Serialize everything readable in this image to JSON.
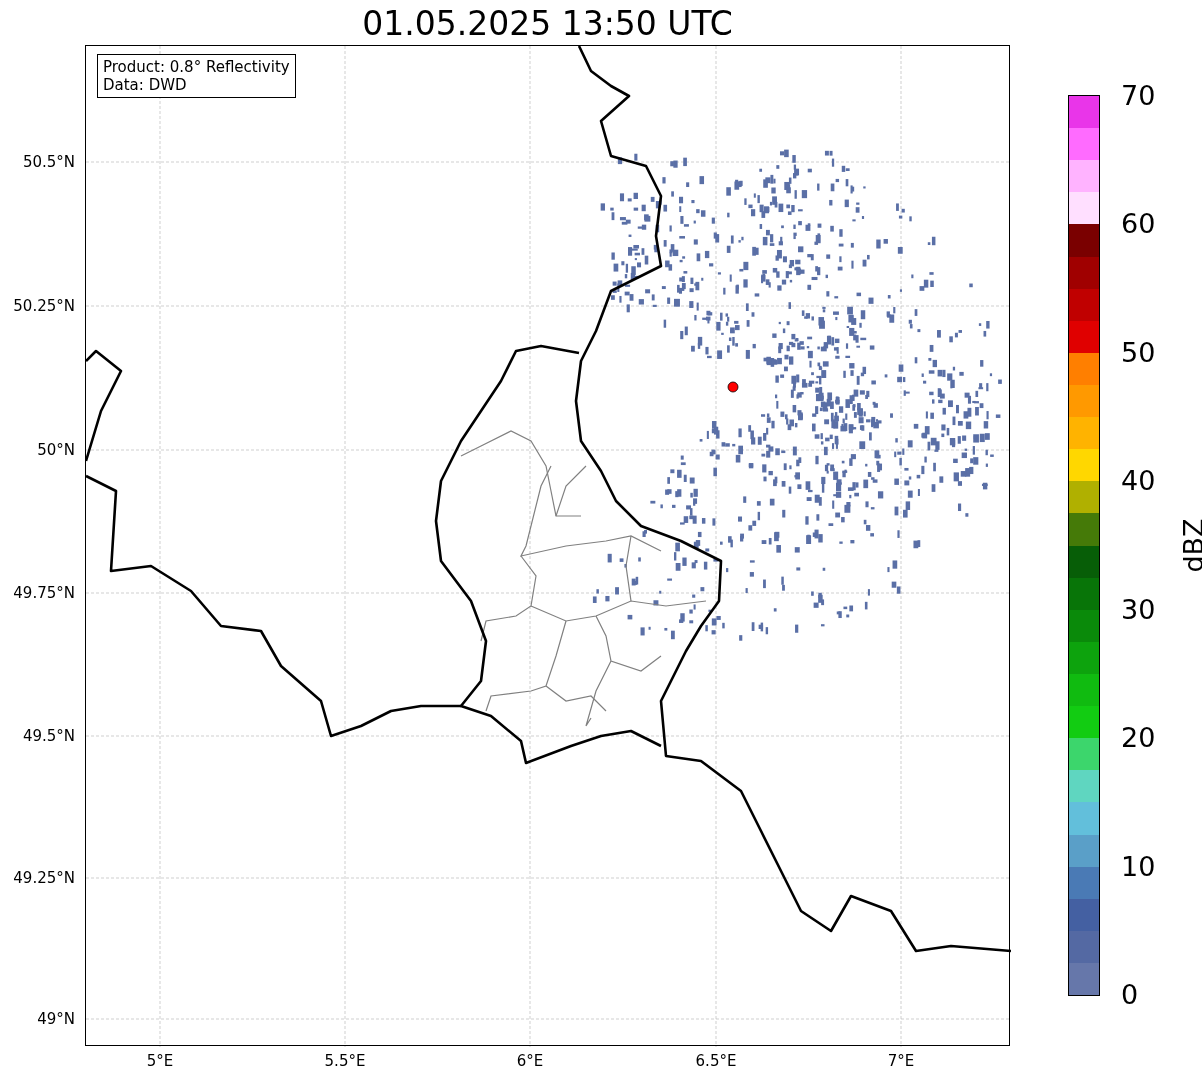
{
  "title": "01.05.2025 13:50 UTC",
  "info_box": [
    "Product: 0.8° Reflectivity",
    "Data: DWD"
  ],
  "map": {
    "yticks": [
      "50.5°N",
      "50.25°N",
      "50°N",
      "49.75°N",
      "49.5°N",
      "49.25°N",
      "49°N"
    ],
    "xticks": [
      "5°E",
      "5.5°E",
      "6°E",
      "6.5°E",
      "7°E"
    ]
  },
  "colorbar": {
    "label": "dBZ",
    "ticks": [
      "70",
      "60",
      "50",
      "40",
      "30",
      "20",
      "10",
      "0"
    ],
    "bins": [
      {
        "color": "#e935e9"
      },
      {
        "color": "#ff6bff"
      },
      {
        "color": "#ffb3ff"
      },
      {
        "color": "#ffdfff"
      },
      {
        "color": "#7a0000"
      },
      {
        "color": "#a00000"
      },
      {
        "color": "#c00000"
      },
      {
        "color": "#e00000"
      },
      {
        "color": "#ff7f00"
      },
      {
        "color": "#ff9900"
      },
      {
        "color": "#ffb300"
      },
      {
        "color": "#ffd700"
      },
      {
        "color": "#b0b000"
      },
      {
        "color": "#457a08"
      },
      {
        "color": "#075e07"
      },
      {
        "color": "#087508"
      },
      {
        "color": "#0a8a0a"
      },
      {
        "color": "#0da30d"
      },
      {
        "color": "#10bb10"
      },
      {
        "color": "#12cc12"
      },
      {
        "color": "#3cd66c"
      },
      {
        "color": "#5fd6c0"
      },
      {
        "color": "#62bfdb"
      },
      {
        "color": "#5a9fc8"
      },
      {
        "color": "#4a7ab5"
      },
      {
        "color": "#4460a2"
      },
      {
        "color": "#5469a3"
      },
      {
        "color": "#6677aa"
      }
    ]
  }
}
